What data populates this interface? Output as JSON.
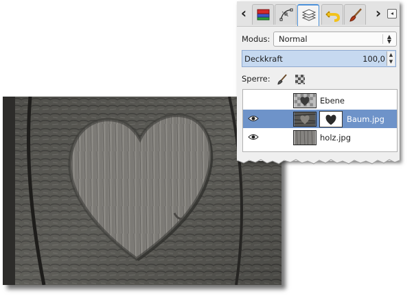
{
  "canvas": {
    "image_icon": "heart-carved-tree-photo"
  },
  "dock": {
    "tabs": [
      {
        "icon": "channels-icon",
        "active": false
      },
      {
        "icon": "paths-icon",
        "active": false
      },
      {
        "icon": "layers-icon",
        "active": true
      },
      {
        "icon": "undo-history-icon",
        "active": false
      },
      {
        "icon": "brushes-icon",
        "active": false
      }
    ],
    "arrow_left": "‹",
    "arrow_right": "›",
    "menu_icon": "◂"
  },
  "mode": {
    "label": "Modus:",
    "value": "Normal"
  },
  "opacity": {
    "label": "Deckkraft",
    "value": "100,0"
  },
  "lock": {
    "label": "Sperre:",
    "icons": [
      "paint-lock-icon",
      "alpha-lock-icon"
    ]
  },
  "layers": [
    {
      "name": "Ebene",
      "visible": false,
      "selected": false,
      "has_mask": false
    },
    {
      "name": "Baum.jpg",
      "visible": true,
      "selected": true,
      "has_mask": true
    },
    {
      "name": "holz.jpg",
      "visible": true,
      "selected": false,
      "has_mask": false
    }
  ]
}
